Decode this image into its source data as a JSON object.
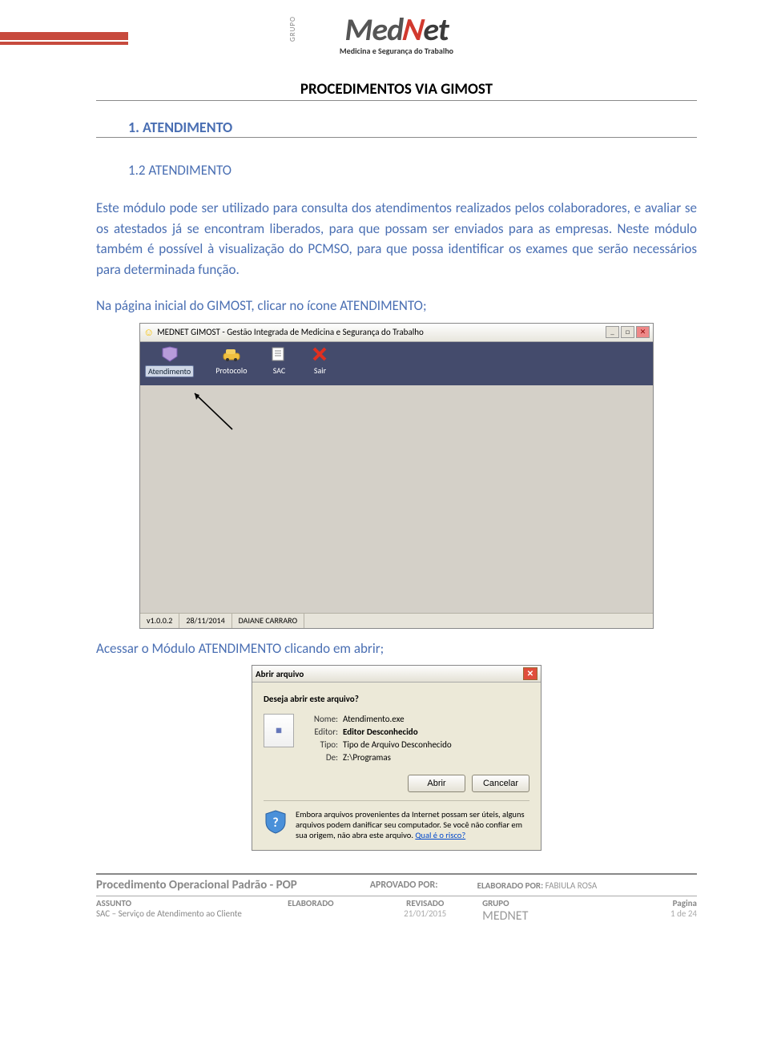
{
  "logo": {
    "side": "GRUPO",
    "main_med": "Med",
    "main_n": "N",
    "main_et": "et",
    "sub": "Medicina e Segurança do Trabalho"
  },
  "doc_title": "PROCEDIMENTOS VIA GIMOST",
  "section1": "1.  ATENDIMENTO",
  "section12": "1.2 ATENDIMENTO",
  "para1": "Este módulo pode ser utilizado para consulta dos atendimentos realizados pelos colaboradores, e avaliar se os atestados já se encontram liberados, para que possam ser enviados para as empresas. Neste módulo também é possível à visualização do PCMSO, para que possa identificar os exames que serão necessários para determinada função.",
  "para2": "Na página inicial do GIMOST, clicar no ícone ATENDIMENTO;",
  "scr1": {
    "title": "MEDNET GIMOST - Gestão Integrada de Medicina e Segurança do Trabalho",
    "items": [
      {
        "icon": "atendimento",
        "label": "Atendimento"
      },
      {
        "icon": "protocolo",
        "label": "Protocolo"
      },
      {
        "icon": "sac",
        "label": "SAC"
      },
      {
        "icon": "sair",
        "label": "Sair"
      }
    ],
    "status": {
      "ver": "v1.0.0.2",
      "date": "28/11/2014",
      "user": "DAIANE CARRARO"
    }
  },
  "para3": "Acessar o Módulo ATENDIMENTO clicando em abrir;",
  "scr2": {
    "title": "Abrir arquivo",
    "question": "Deseja abrir este arquivo?",
    "rows": {
      "nome_l": "Nome:",
      "nome_v": "Atendimento.exe",
      "editor_l": "Editor:",
      "editor_v": "Editor Desconhecido",
      "tipo_l": "Tipo:",
      "tipo_v": "Tipo de Arquivo Desconhecido",
      "de_l": "De:",
      "de_v": "Z:\\Programas"
    },
    "btn_abrir": "Abrir",
    "btn_cancel": "Cancelar",
    "warn": "Embora arquivos provenientes da Internet possam ser úteis, alguns arquivos podem danificar seu computador. Se você não confiar em sua origem, não abra este arquivo. ",
    "warn_link": "Qual é o risco?"
  },
  "footer": {
    "title": "Procedimento Operacional Padrão - POP",
    "aprovado": "APROVADO POR:",
    "elaborado_por": "ELABORADO POR:",
    "elaborado_por_v": "FABIULA ROSA",
    "assunto_l": "ASSUNTO",
    "assunto_v": "SAC – Serviço de Atendimento ao Cliente",
    "elaborado": "ELABORADO",
    "revisado": "REVISADO",
    "revisado_v": "21/01/2015",
    "grupo_l": "GRUPO",
    "grupo_v": "MEDNET",
    "pagina_l": "Pagina",
    "pagina_v": "1 de 24"
  }
}
